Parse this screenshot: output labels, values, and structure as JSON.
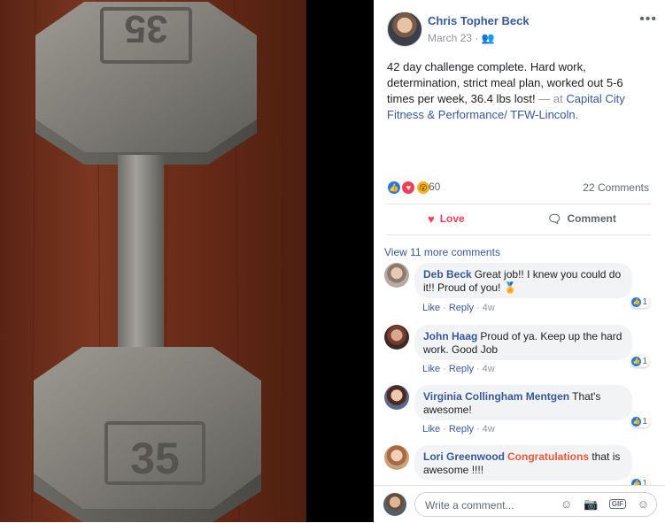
{
  "post": {
    "author": "Chris Topher Beck",
    "date": "March 23",
    "privacy_glyph": "·  👥",
    "options_glyph": "•••",
    "text": "42 day challenge complete. Hard work, determination, strict meal plan, worked out 5-6 times per week, 36.4 lbs lost!",
    "location_prefix": " — at ",
    "location": "Capital City Fitness & Performance/ TFW-Lincoln.",
    "reactions_count": "60",
    "comments_count": "22 Comments",
    "love_label": "Love",
    "comment_label": "Comment",
    "love_icon": "♥",
    "comment_icon": "🗨"
  },
  "photo": {
    "weight_top": "35",
    "weight_bottom": "35"
  },
  "comments": {
    "view_more": "View 11 more comments",
    "items": [
      {
        "name": "Deb Beck",
        "text": "Great job!! I knew you could do it!! Proud of you! 🏅",
        "like": "Like",
        "reply": "Reply",
        "time": "4w",
        "likes": "1"
      },
      {
        "name": "John Haag",
        "text": "Proud of ya. Keep up the hard work. Good Job",
        "like": "Like",
        "reply": "Reply",
        "time": "4w",
        "likes": "1"
      },
      {
        "name": "Virginia Collingham Mentgen",
        "text": "That's awesome!",
        "like": "Like",
        "reply": "Reply",
        "time": "4w",
        "likes": "1"
      },
      {
        "name": "Lori Greenwood",
        "highlight": "Congratulations",
        "text": " that is awesome !!!!",
        "likes": "1"
      }
    ]
  },
  "composer": {
    "placeholder": "Write a comment...",
    "emoji_icon": "☺",
    "camera_icon": "📷",
    "gif_label": "GIF",
    "sticker_icon": "☺"
  },
  "colors": {
    "link": "#385898",
    "love": "#f33e58",
    "like": "#2078f4"
  }
}
